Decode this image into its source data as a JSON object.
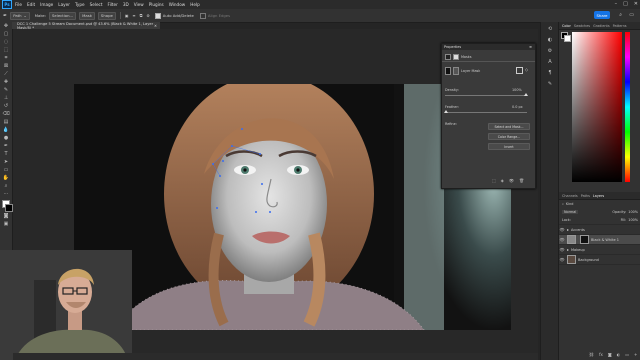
{
  "menu": [
    "File",
    "Edit",
    "Image",
    "Layer",
    "Type",
    "Select",
    "Filter",
    "3D",
    "View",
    "Plugins",
    "Window",
    "Help"
  ],
  "options": {
    "path_label": "Path",
    "make_label": "Make:",
    "selection_label": "Selection...",
    "mask_label": "Mask",
    "shape_label": "Shape",
    "auto_add_delete": "Auto Add/Delete",
    "align_edges": "Align Edges",
    "share_label": "Share"
  },
  "document": {
    "tab_title": "DCC 1 Challenge 5 Stream Document.psd @ 43.6% (Black & White 1, Layer Mask/8) *"
  },
  "properties": {
    "title": "Properties",
    "header_label": "Masks",
    "mask_label": "Layer Mask",
    "density_label": "Density:",
    "density_value": "100%",
    "feather_label": "Feather:",
    "feather_value": "0.0 px",
    "refine_label": "Refine:",
    "select_mask_btn": "Select and Mask...",
    "color_range_btn": "Color Range...",
    "invert_btn": "Invert"
  },
  "right_panels": {
    "top_tabs": [
      "Color",
      "Swatches",
      "Gradients",
      "Patterns"
    ],
    "layer_tabs": [
      "Channels",
      "Paths",
      "Layers"
    ],
    "kind_label": "Kind",
    "blend_mode": "Normal",
    "opacity_label": "Opacity:",
    "opacity_value": "100%",
    "lock_label": "Lock:",
    "fill_label": "Fill:",
    "fill_value": "100%",
    "layers": [
      {
        "name": "Accents",
        "selected": false
      },
      {
        "name": "Black & White 1",
        "selected": true
      },
      {
        "name": "Makeup",
        "selected": false
      },
      {
        "name": "Background",
        "selected": false
      }
    ]
  },
  "colors": {
    "accent": "#1473e6",
    "panel": "#323232",
    "canvas": "#282828"
  }
}
